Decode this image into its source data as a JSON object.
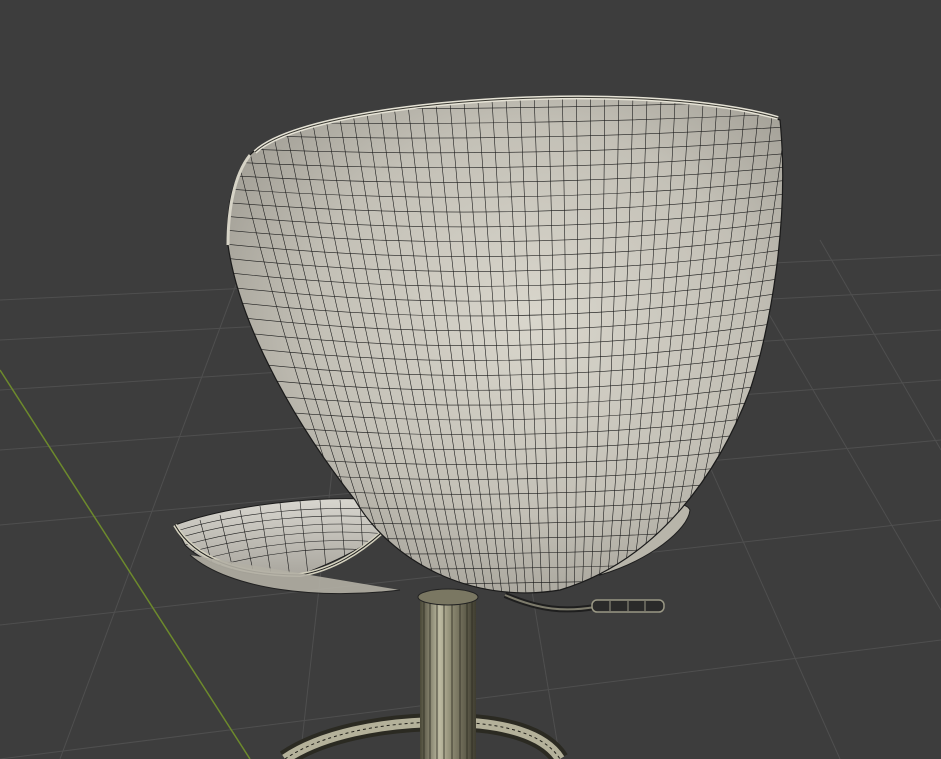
{
  "viewport": {
    "background": "#3d3d3d",
    "grid_color": "#4f4f4f",
    "y_axis_color": "#6d8a2c"
  },
  "model": {
    "display_mode": "wireframe-on-shaded",
    "surface_color": "#c9c6bd",
    "wire_color": "#1c1c1c",
    "metal_color": "#a7a48f"
  }
}
